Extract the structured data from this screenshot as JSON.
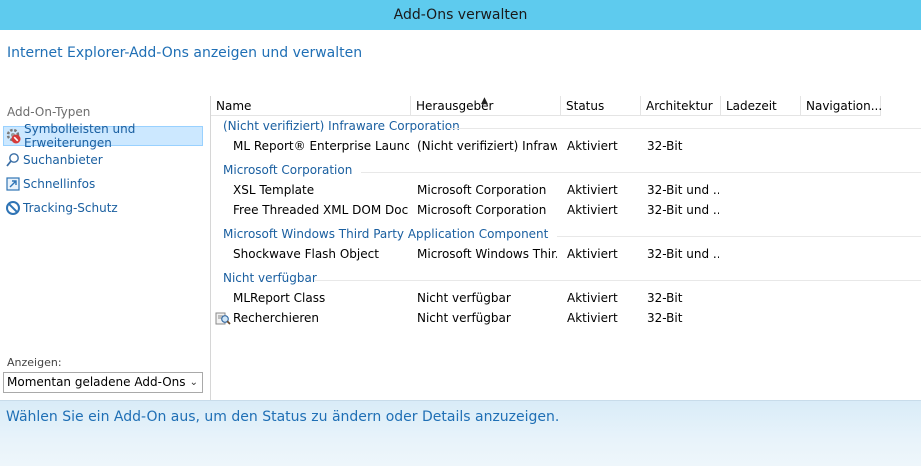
{
  "window": {
    "title": "Add-Ons verwalten"
  },
  "header": {
    "heading": "Internet Explorer-Add-Ons anzeigen und verwalten"
  },
  "sidebar": {
    "types_label": "Add-On-Typen",
    "items": [
      {
        "label": "Symbolleisten und Erweiterungen",
        "icon": "toolbar-extension-icon",
        "selected": true
      },
      {
        "label": "Suchanbieter",
        "icon": "search-icon",
        "selected": false
      },
      {
        "label": "Schnellinfos",
        "icon": "accelerator-icon",
        "selected": false
      },
      {
        "label": "Tracking-Schutz",
        "icon": "tracking-protection-icon",
        "selected": false
      }
    ],
    "show_label": "Anzeigen:",
    "show_select": {
      "value": "Momentan geladene Add-Ons"
    }
  },
  "list": {
    "columns": [
      "Name",
      "Herausgeber",
      "Status",
      "Architektur",
      "Ladezeit",
      "Navigation..."
    ],
    "sorted_column": "Herausgeber",
    "groups": [
      {
        "name": "(Nicht verifiziert) Infraware Corporation",
        "rows": [
          {
            "name": "ML Report® Enterprise Launcher",
            "publisher": "(Nicht verifiziert) Infraw...",
            "status": "Aktiviert",
            "arch": "32-Bit",
            "load": "",
            "nav": ""
          }
        ]
      },
      {
        "name": "Microsoft Corporation",
        "rows": [
          {
            "name": "XSL Template",
            "publisher": "Microsoft Corporation",
            "status": "Aktiviert",
            "arch": "32-Bit und ...",
            "load": "",
            "nav": ""
          },
          {
            "name": "Free Threaded XML DOM Docu...",
            "publisher": "Microsoft Corporation",
            "status": "Aktiviert",
            "arch": "32-Bit und ...",
            "load": "",
            "nav": ""
          }
        ]
      },
      {
        "name": "Microsoft Windows Third Party Application Component",
        "rows": [
          {
            "name": "Shockwave Flash Object",
            "publisher": "Microsoft Windows Thir...",
            "status": "Aktiviert",
            "arch": "32-Bit und ...",
            "load": "",
            "nav": ""
          }
        ]
      },
      {
        "name": "Nicht verfügbar",
        "rows": [
          {
            "name": "MLReport Class",
            "publisher": "Nicht verfügbar",
            "status": "Aktiviert",
            "arch": "32-Bit",
            "load": "",
            "nav": ""
          },
          {
            "name": "Recherchieren",
            "publisher": "Nicht verfügbar",
            "status": "Aktiviert",
            "arch": "32-Bit",
            "load": "",
            "nav": "",
            "icon": "research-icon"
          }
        ]
      }
    ]
  },
  "footer": {
    "message": "Wählen Sie ein Add-On aus, um den Status zu ändern oder Details anzuzeigen."
  }
}
